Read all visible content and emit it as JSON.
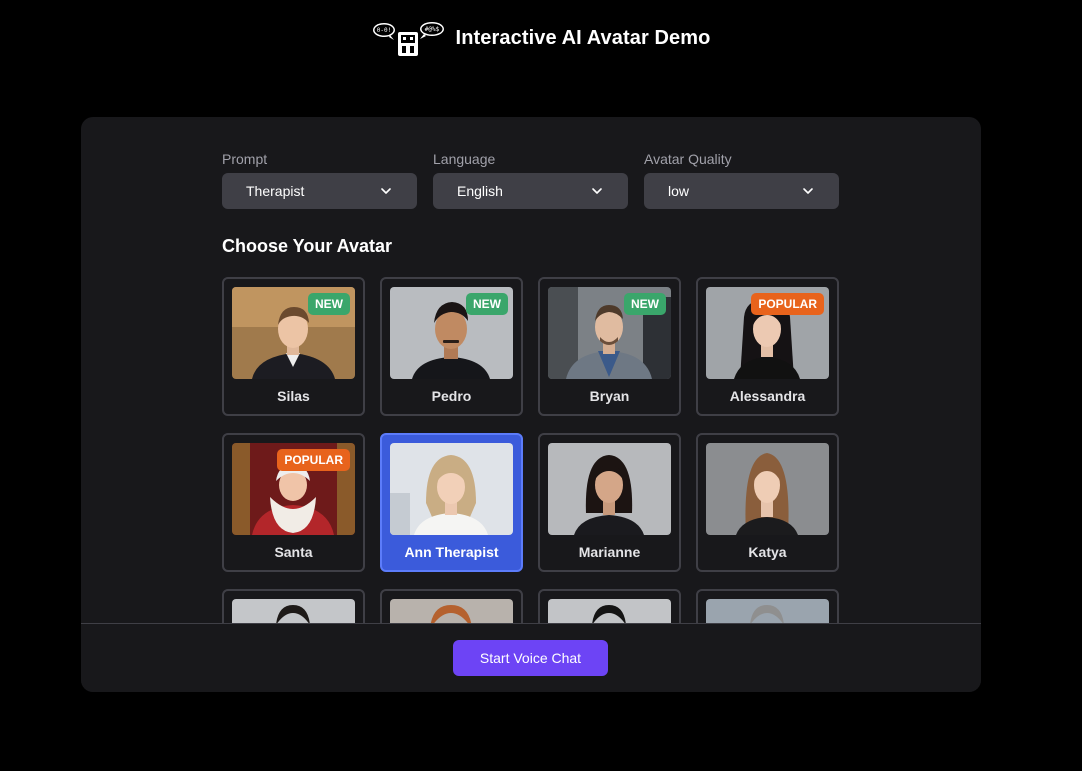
{
  "header": {
    "title": "Interactive AI Avatar Demo",
    "logo_icon": "robot-chat-logo-icon"
  },
  "controls": {
    "prompt": {
      "label": "Prompt",
      "value": "Therapist"
    },
    "language": {
      "label": "Language",
      "value": "English"
    },
    "quality": {
      "label": "Avatar Quality",
      "value": "low"
    }
  },
  "avatars": {
    "heading": "Choose Your Avatar",
    "items": [
      {
        "name": "Silas",
        "badge": "NEW",
        "selected": false
      },
      {
        "name": "Pedro",
        "badge": "NEW",
        "selected": false
      },
      {
        "name": "Bryan",
        "badge": "NEW",
        "selected": false
      },
      {
        "name": "Alessandra",
        "badge": "POPULAR",
        "selected": false
      },
      {
        "name": "Santa",
        "badge": "POPULAR",
        "selected": false
      },
      {
        "name": "Ann Therapist",
        "badge": "",
        "selected": true
      },
      {
        "name": "Marianne",
        "badge": "",
        "selected": false
      },
      {
        "name": "Katya",
        "badge": "",
        "selected": false
      }
    ]
  },
  "footer": {
    "start_label": "Start Voice Chat"
  },
  "colors": {
    "accent": "#6d44f5",
    "selected": "#3b5bdb",
    "new_badge": "#3aa66b",
    "popular_badge": "#e8631c"
  }
}
